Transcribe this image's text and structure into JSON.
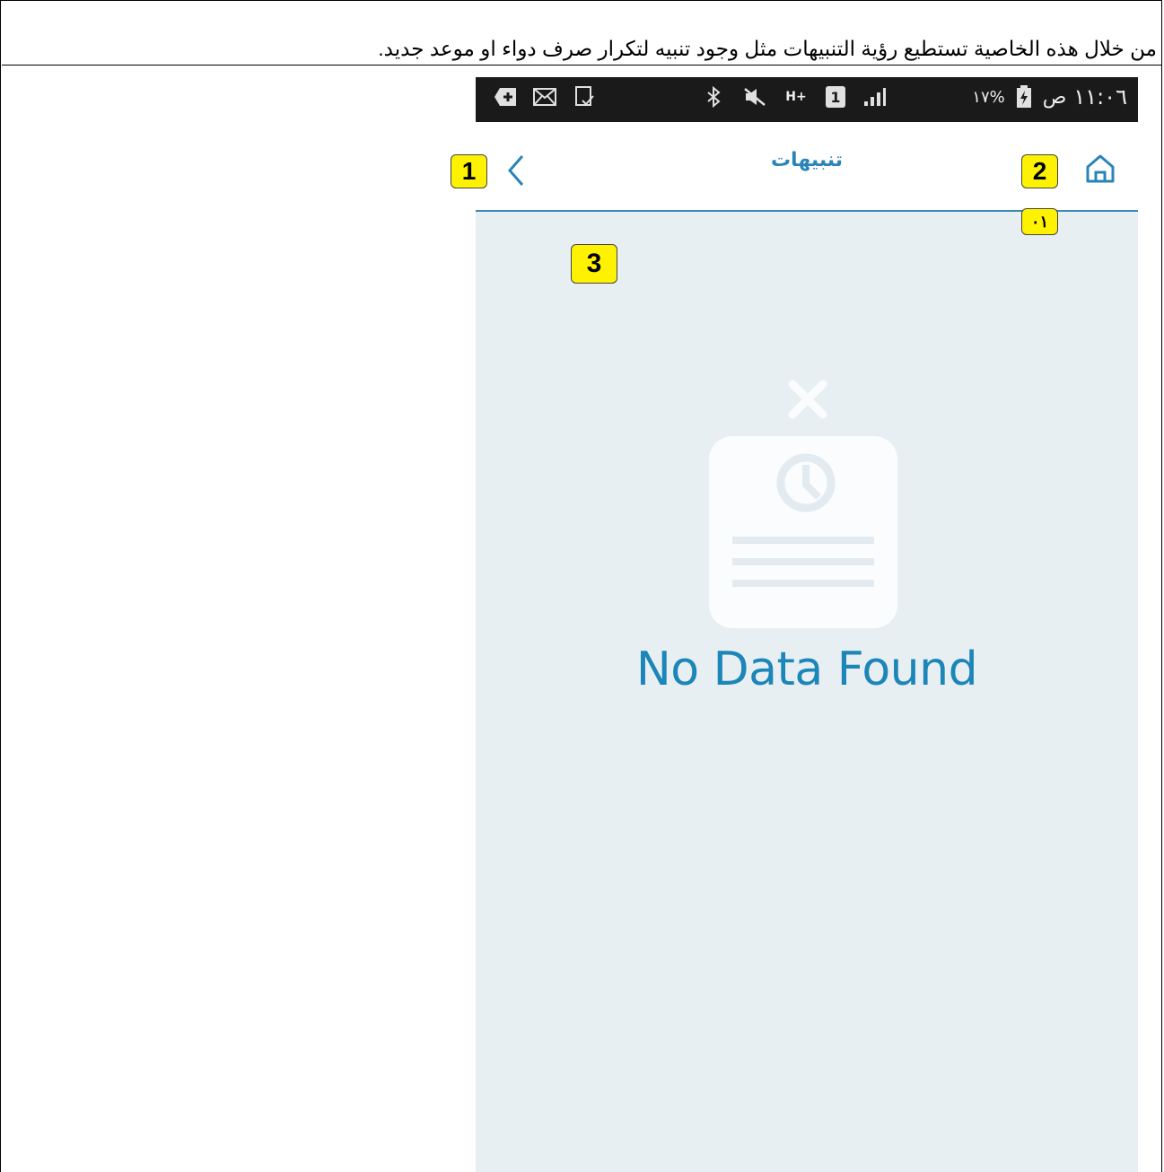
{
  "document": {
    "caption": "من خلال هذه الخاصية تستطيع رؤية التنبيهات مثل وجود تنبيه  لتكرار صرف دواء او موعد جديد."
  },
  "statusbar": {
    "time": "١١:٠٦",
    "am_pm": "ص",
    "battery_percent": "١٧%",
    "network": "H+",
    "sim": "1",
    "icons_left": [
      "add-box-icon",
      "mail-icon",
      "screenshot-icon"
    ],
    "icons_mid": [
      "bluetooth-icon",
      "mute-icon",
      "data-arrows-icon",
      "sim-icon",
      "signal-icon"
    ]
  },
  "appbar": {
    "title": "تنبيهات",
    "back_icon": "chevron-left-icon",
    "home_icon": "home-icon"
  },
  "callouts": {
    "back": "1",
    "home": "2",
    "content": "3",
    "sub": "٠١"
  },
  "empty_state": {
    "message": "No Data Found",
    "icon": "no-data-document-icon"
  },
  "colors": {
    "accent": "#2a84b8",
    "content_bg": "#e8eff3",
    "statusbar_bg": "#1a1a1a",
    "callout_bg": "#fff200"
  }
}
